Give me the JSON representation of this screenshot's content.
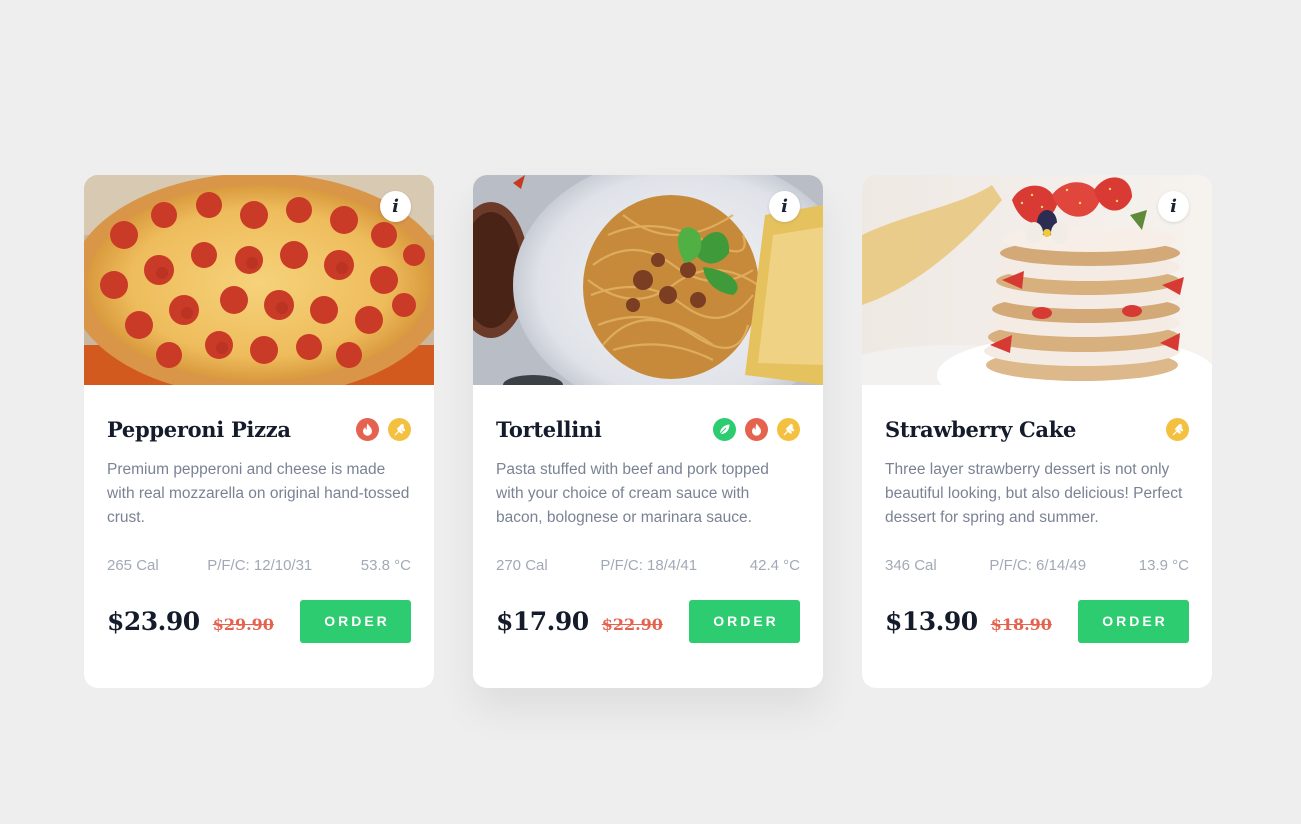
{
  "colors": {
    "background": "#eeeeee",
    "card": "#ffffff",
    "order_button": "#2dcc70",
    "old_price": "#e5624f",
    "badge_spicy": "#e5624f",
    "badge_grain": "#f4c03f",
    "badge_vegan": "#2dcc70"
  },
  "cards": [
    {
      "photo_subject": "pepperoni-pizza-photo",
      "info_icon_glyph": "i",
      "title": "Pepperoni Pizza",
      "badges": [
        "flame-icon",
        "wheat-icon"
      ],
      "description": "Premium pepperoni and cheese is made with real mozzarella on original hand-tossed crust.",
      "calories": "265 Cal",
      "pfc": "P/F/C: 12/10/31",
      "temperature": "53.8 °C",
      "price": "$23.90",
      "old_price": "$29.90",
      "order_label": "ORDER"
    },
    {
      "photo_subject": "tortellini-pasta-photo",
      "info_icon_glyph": "i",
      "title": "Tortellini",
      "badges": [
        "leaf-icon",
        "flame-icon",
        "wheat-icon"
      ],
      "description": "Pasta stuffed with beef and pork topped with your choice of cream sauce with bacon, bolognese or marinara sauce.",
      "calories": "270 Cal",
      "pfc": "P/F/C: 18/4/41",
      "temperature": "42.4 °C",
      "price": "$17.90",
      "old_price": "$22.90",
      "order_label": "ORDER"
    },
    {
      "photo_subject": "strawberry-cake-photo",
      "info_icon_glyph": "i",
      "title": "Strawberry Cake",
      "badges": [
        "wheat-icon"
      ],
      "description": "Three layer strawberry dessert is not only beautiful looking, but also delicious! Perfect dessert for spring and summer.",
      "calories": "346 Cal",
      "pfc": "P/F/C: 6/14/49",
      "temperature": "13.9 °C",
      "price": "$13.90",
      "old_price": "$18.90",
      "order_label": "ORDER"
    }
  ]
}
